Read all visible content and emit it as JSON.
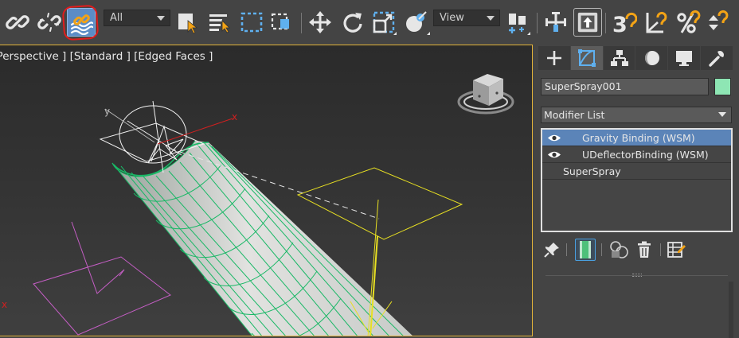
{
  "toolbar": {
    "icons": [
      {
        "name": "link-icon",
        "state": "normal"
      },
      {
        "name": "unlink-icon",
        "state": "normal"
      },
      {
        "name": "bind-to-space-warp-icon",
        "state": "active"
      },
      {
        "name": "select-object-icon",
        "state": "normal"
      },
      {
        "name": "select-by-name-icon",
        "state": "normal"
      },
      {
        "name": "rectangular-selection-icon",
        "state": "normal"
      },
      {
        "name": "window-crossing-icon",
        "state": "normal"
      },
      {
        "name": "move-icon",
        "state": "normal"
      },
      {
        "name": "rotate-icon",
        "state": "normal"
      },
      {
        "name": "scale-icon",
        "state": "normal"
      },
      {
        "name": "placement-icon",
        "state": "normal"
      },
      {
        "name": "use-pivot-center-icon",
        "state": "normal"
      },
      {
        "name": "select-and-manipulate-icon",
        "state": "normal"
      },
      {
        "name": "keyboard-shortcut-override-icon",
        "state": "active"
      },
      {
        "name": "snaps-toggle-icon",
        "state": "normal"
      },
      {
        "name": "angle-snap-icon",
        "state": "normal"
      },
      {
        "name": "percent-snap-icon",
        "state": "normal"
      },
      {
        "name": "spinner-snap-icon",
        "state": "normal"
      }
    ],
    "selection_filter": {
      "value": "All"
    },
    "reference_coord": {
      "value": "View"
    },
    "snap_label": "3",
    "highlight_color": "#e11c1c",
    "active_color": "#5b8cc6"
  },
  "viewport": {
    "label": "[ Perspective ] [Standard ] [Edged Faces ]",
    "border_color": "#e2b33a",
    "axis_labels": {
      "x": "x",
      "y": "y",
      "x2": "x"
    },
    "colors": {
      "tube_fill": "#dcdcdc",
      "tube_wire": "#19b866",
      "deflector": "#e8e022",
      "gravity": "#c55ec5",
      "emitter": "#ffffff",
      "axis_x": "#d02020"
    }
  },
  "panel": {
    "tabs": [
      {
        "name": "create-tab",
        "icon": "plus-icon",
        "active": false
      },
      {
        "name": "modify-tab",
        "icon": "modify-icon",
        "active": true
      },
      {
        "name": "hierarchy-tab",
        "icon": "hierarchy-icon",
        "active": false
      },
      {
        "name": "motion-tab",
        "icon": "motion-icon",
        "active": false
      },
      {
        "name": "display-tab",
        "icon": "display-icon",
        "active": false
      },
      {
        "name": "utilities-tab",
        "icon": "wrench-icon",
        "active": false
      }
    ],
    "object_name": "SuperSpray001",
    "object_color": "#8ee6b4",
    "modifier_list_label": "Modifier List",
    "stack": [
      {
        "label": "Gravity Binding (WSM)",
        "eye": true,
        "selected": true
      },
      {
        "label": "UDeflectorBinding (WSM)",
        "eye": true,
        "selected": false
      },
      {
        "label": "SuperSpray",
        "eye": false,
        "selected": false
      }
    ],
    "stack_tools": [
      {
        "name": "pin-stack-icon"
      },
      {
        "name": "show-end-result-icon"
      },
      {
        "name": "make-unique-icon"
      },
      {
        "name": "remove-modifier-icon"
      },
      {
        "name": "configure-modifier-sets-icon"
      }
    ]
  }
}
